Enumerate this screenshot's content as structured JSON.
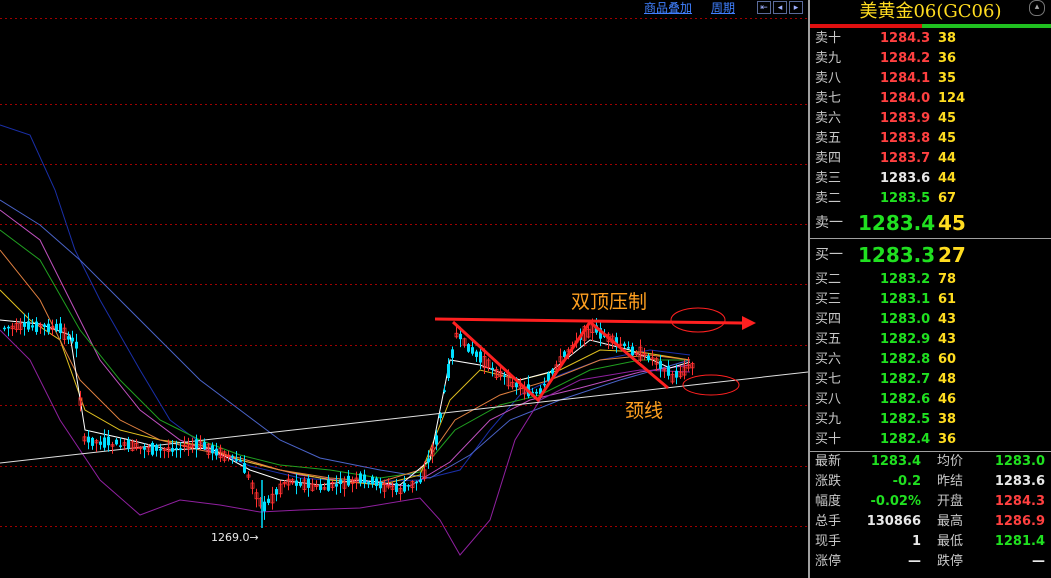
{
  "toolbar": {
    "overlay_label": "商品叠加",
    "period_label": "周期"
  },
  "chart": {
    "low_label": "1269.0",
    "annotation_top": "双顶压制",
    "annotation_neck": "颈线",
    "colors": {
      "up": "#ff3030",
      "down": "#00e0ff",
      "grid": "#a00000",
      "annotation": "#ffa020",
      "arrow": "#ff2020"
    }
  },
  "chart_data": {
    "type": "candlestick",
    "title": "",
    "marked_low": 1269.0,
    "annotations": [
      "双顶压制",
      "颈线"
    ]
  },
  "panel": {
    "title": "美黄金06(GC06)",
    "asks": [
      {
        "label": "卖十",
        "price": "1284.3",
        "vol": "38",
        "color": "red"
      },
      {
        "label": "卖九",
        "price": "1284.2",
        "vol": "36",
        "color": "red"
      },
      {
        "label": "卖八",
        "price": "1284.1",
        "vol": "35",
        "color": "red"
      },
      {
        "label": "卖七",
        "price": "1284.0",
        "vol": "124",
        "color": "red"
      },
      {
        "label": "卖六",
        "price": "1283.9",
        "vol": "45",
        "color": "red"
      },
      {
        "label": "卖五",
        "price": "1283.8",
        "vol": "45",
        "color": "red"
      },
      {
        "label": "卖四",
        "price": "1283.7",
        "vol": "44",
        "color": "red"
      },
      {
        "label": "卖三",
        "price": "1283.6",
        "vol": "44",
        "color": "white"
      },
      {
        "label": "卖二",
        "price": "1283.5",
        "vol": "67",
        "color": "green"
      },
      {
        "label": "卖一",
        "price": "1283.4",
        "vol": "45",
        "color": "green"
      }
    ],
    "bids": [
      {
        "label": "买一",
        "price": "1283.3",
        "vol": "27",
        "color": "green"
      },
      {
        "label": "买二",
        "price": "1283.2",
        "vol": "78",
        "color": "green"
      },
      {
        "label": "买三",
        "price": "1283.1",
        "vol": "61",
        "color": "green"
      },
      {
        "label": "买四",
        "price": "1283.0",
        "vol": "43",
        "color": "green"
      },
      {
        "label": "买五",
        "price": "1282.9",
        "vol": "43",
        "color": "green"
      },
      {
        "label": "买六",
        "price": "1282.8",
        "vol": "60",
        "color": "green"
      },
      {
        "label": "买七",
        "price": "1282.7",
        "vol": "48",
        "color": "green"
      },
      {
        "label": "买八",
        "price": "1282.6",
        "vol": "46",
        "color": "green"
      },
      {
        "label": "买九",
        "price": "1282.5",
        "vol": "38",
        "color": "green"
      },
      {
        "label": "买十",
        "price": "1282.4",
        "vol": "36",
        "color": "green"
      }
    ],
    "stats": [
      {
        "l1": "最新",
        "v1": "1283.4",
        "c1": "green",
        "l2": "均价",
        "v2": "1283.0",
        "c2": "green"
      },
      {
        "l1": "涨跌",
        "v1": "-0.2",
        "c1": "green",
        "l2": "昨结",
        "v2": "1283.6",
        "c2": "white"
      },
      {
        "l1": "幅度",
        "v1": "-0.02%",
        "c1": "green",
        "l2": "开盘",
        "v2": "1284.3",
        "c2": "red"
      },
      {
        "l1": "总手",
        "v1": "130866",
        "c1": "white",
        "l2": "最高",
        "v2": "1286.9",
        "c2": "red"
      },
      {
        "l1": "现手",
        "v1": "1",
        "c1": "white",
        "l2": "最低",
        "v2": "1281.4",
        "c2": "green"
      },
      {
        "l1": "涨停",
        "v1": "—",
        "c1": "white",
        "l2": "跌停",
        "v2": "—",
        "c2": "white"
      }
    ]
  }
}
